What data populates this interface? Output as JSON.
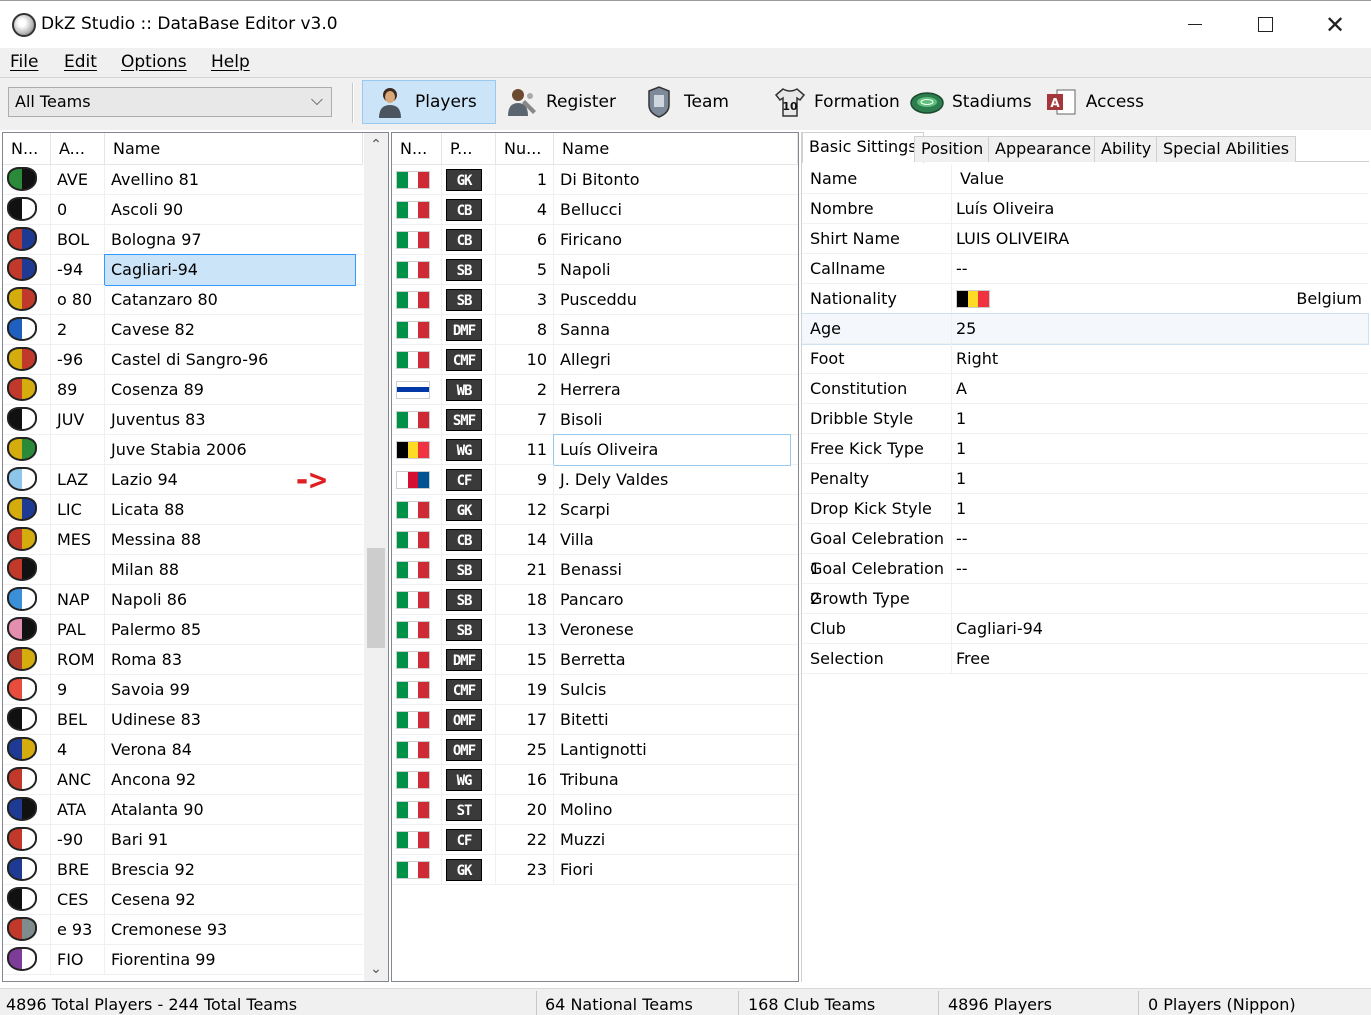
{
  "window": {
    "title": "DkZ Studio :: DataBase Editor v3.0"
  },
  "menu": {
    "file": "File",
    "edit": "Edit",
    "options": "Options",
    "help": "Help"
  },
  "toolbar": {
    "team_filter": "All Teams",
    "players": "Players",
    "register": "Register",
    "team": "Team",
    "formation": "Formation",
    "stadiums": "Stadiums",
    "access": "Access"
  },
  "team_list": {
    "columns": [
      "N...",
      "A...",
      "Name"
    ],
    "rows": [
      {
        "abbr": "AVE",
        "name": "Avellino 81",
        "c1": "#2a8a3a",
        "c2": "#111111"
      },
      {
        "abbr": "0",
        "name": "Ascoli 90",
        "c1": "#111111",
        "c2": "#ffffff"
      },
      {
        "abbr": "BOL",
        "name": "Bologna 97",
        "c1": "#c0392b",
        "c2": "#1f3a93"
      },
      {
        "abbr": "-94",
        "name": "Cagliari-94",
        "c1": "#c0392b",
        "c2": "#1f3a93"
      },
      {
        "abbr": "o 80",
        "name": "Catanzaro 80",
        "c1": "#d4ac0d",
        "c2": "#c0392b"
      },
      {
        "abbr": "2",
        "name": "Cavese 82",
        "c1": "#1f5fbf",
        "c2": "#ffffff"
      },
      {
        "abbr": "-96",
        "name": "Castel di Sangro-96",
        "c1": "#d4ac0d",
        "c2": "#c0392b"
      },
      {
        "abbr": "89",
        "name": "Cosenza 89",
        "c1": "#c0392b",
        "c2": "#d4ac0d"
      },
      {
        "abbr": "JUV",
        "name": "Juventus 83",
        "c1": "#111111",
        "c2": "#ffffff"
      },
      {
        "abbr": "",
        "name": "Juve Stabia 2006",
        "c1": "#d4ac0d",
        "c2": "#2a8a3a"
      },
      {
        "abbr": "LAZ",
        "name": "Lazio 94",
        "c1": "#8ec5ea",
        "c2": "#ffffff"
      },
      {
        "abbr": "LIC",
        "name": "Licata 88",
        "c1": "#d4ac0d",
        "c2": "#1f3a93"
      },
      {
        "abbr": "MES",
        "name": "Messina 88",
        "c1": "#c0392b",
        "c2": "#d4ac0d"
      },
      {
        "abbr": "",
        "name": "Milan 88",
        "c1": "#c0392b",
        "c2": "#111111"
      },
      {
        "abbr": "NAP",
        "name": "Napoli 86",
        "c1": "#3b8fd9",
        "c2": "#ffffff"
      },
      {
        "abbr": "PAL",
        "name": "Palermo 85",
        "c1": "#e58fb0",
        "c2": "#111111"
      },
      {
        "abbr": "ROM",
        "name": "Roma 83",
        "c1": "#b03a2e",
        "c2": "#d4ac0d"
      },
      {
        "abbr": "9",
        "name": "Savoia 99",
        "c1": "#e74c3c",
        "c2": "#ffffff"
      },
      {
        "abbr": "BEL",
        "name": "Udinese 83",
        "c1": "#111111",
        "c2": "#ffffff"
      },
      {
        "abbr": "4",
        "name": "Verona 84",
        "c1": "#1f3a93",
        "c2": "#d4ac0d"
      },
      {
        "abbr": "ANC",
        "name": "Ancona 92",
        "c1": "#c0392b",
        "c2": "#ffffff"
      },
      {
        "abbr": "ATA",
        "name": "Atalanta 90",
        "c1": "#1f3a93",
        "c2": "#111111"
      },
      {
        "abbr": "-90",
        "name": "Bari 91",
        "c1": "#c0392b",
        "c2": "#ffffff"
      },
      {
        "abbr": "BRE",
        "name": "Brescia 92",
        "c1": "#1f3a93",
        "c2": "#ffffff"
      },
      {
        "abbr": "CES",
        "name": "Cesena 92",
        "c1": "#111111",
        "c2": "#ffffff"
      },
      {
        "abbr": "e 93",
        "name": "Cremonese 93",
        "c1": "#c0392b",
        "c2": "#7f8c8d"
      },
      {
        "abbr": "FIO",
        "name": "Fiorentina 99",
        "c1": "#7d3c98",
        "c2": "#ffffff"
      }
    ]
  },
  "player_list": {
    "columns": [
      "N...",
      "P...",
      "Nu...",
      "Name"
    ],
    "rows": [
      {
        "flag": "italy",
        "pos": "GK",
        "num": "1",
        "name": "Di Bitonto"
      },
      {
        "flag": "italy",
        "pos": "CB",
        "num": "4",
        "name": "Bellucci"
      },
      {
        "flag": "italy",
        "pos": "CB",
        "num": "6",
        "name": "Firicano"
      },
      {
        "flag": "italy",
        "pos": "SB",
        "num": "5",
        "name": "Napoli"
      },
      {
        "flag": "italy",
        "pos": "SB",
        "num": "3",
        "name": "Pusceddu"
      },
      {
        "flag": "italy",
        "pos": "DMF",
        "num": "8",
        "name": "Sanna"
      },
      {
        "flag": "italy",
        "pos": "CMF",
        "num": "10",
        "name": "Allegri"
      },
      {
        "flag": "uruguay",
        "pos": "WB",
        "num": "2",
        "name": "Herrera"
      },
      {
        "flag": "italy",
        "pos": "SMF",
        "num": "7",
        "name": "Bisoli"
      },
      {
        "flag": "belgium",
        "pos": "WG",
        "num": "11",
        "name": "Luís Oliveira"
      },
      {
        "flag": "panama",
        "pos": "CF",
        "num": "9",
        "name": "J. Dely Valdes"
      },
      {
        "flag": "italy",
        "pos": "GK",
        "num": "12",
        "name": "Scarpi"
      },
      {
        "flag": "italy",
        "pos": "CB",
        "num": "14",
        "name": "Villa"
      },
      {
        "flag": "italy",
        "pos": "SB",
        "num": "21",
        "name": "Benassi"
      },
      {
        "flag": "italy",
        "pos": "SB",
        "num": "18",
        "name": "Pancaro"
      },
      {
        "flag": "italy",
        "pos": "SB",
        "num": "13",
        "name": "Veronese"
      },
      {
        "flag": "italy",
        "pos": "DMF",
        "num": "15",
        "name": "Berretta"
      },
      {
        "flag": "italy",
        "pos": "CMF",
        "num": "19",
        "name": "Sulcis"
      },
      {
        "flag": "italy",
        "pos": "OMF",
        "num": "17",
        "name": "Bitetti"
      },
      {
        "flag": "italy",
        "pos": "OMF",
        "num": "25",
        "name": "Lantignotti"
      },
      {
        "flag": "italy",
        "pos": "WG",
        "num": "16",
        "name": "Tribuna"
      },
      {
        "flag": "italy",
        "pos": "ST",
        "num": "20",
        "name": "Molino"
      },
      {
        "flag": "italy",
        "pos": "CF",
        "num": "22",
        "name": "Muzzi"
      },
      {
        "flag": "italy",
        "pos": "GK",
        "num": "23",
        "name": "Fiori"
      }
    ]
  },
  "flags": {
    "italy": [
      "#009246",
      "#ffffff",
      "#ce2b37"
    ],
    "belgium": [
      "#000000",
      "#fdda24",
      "#ef3340"
    ],
    "uruguay": [
      "#ffffff",
      "#0038a8",
      "#ffffff"
    ],
    "panama": [
      "#ffffff",
      "#d21034",
      "#005293"
    ]
  },
  "tabs": [
    "Basic Sittings",
    "Position",
    "Appearance",
    "Ability",
    "Special Abilities"
  ],
  "properties": {
    "header": {
      "key": "Name",
      "value": "Value"
    },
    "rows": [
      {
        "key": "Nombre",
        "value": "Luís Oliveira"
      },
      {
        "key": "Shirt Name",
        "value": "LUIS OLIVEIRA"
      },
      {
        "key": "Callname",
        "value": "--"
      },
      {
        "key": "Nationality",
        "value": "Belgium"
      },
      {
        "key": "Age",
        "value": "25"
      },
      {
        "key": "Foot",
        "value": "Right"
      },
      {
        "key": "Constitution",
        "value": "A"
      },
      {
        "key": "Dribble Style",
        "value": "1"
      },
      {
        "key": "Free Kick Type",
        "value": "1"
      },
      {
        "key": "Penalty",
        "value": "1"
      },
      {
        "key": "Drop Kick Style",
        "value": "1"
      },
      {
        "key": "Goal Celebration 1",
        "value": "--"
      },
      {
        "key": "Goal Celebration 2",
        "value": "--"
      },
      {
        "key": "Growth Type",
        "value": ""
      },
      {
        "key": "Club",
        "value": "Cagliari-94"
      },
      {
        "key": "Selection",
        "value": "Free"
      }
    ]
  },
  "annotation": {
    "arrow": "->"
  },
  "status": {
    "totals": "4896 Total Players  -  244 Total Teams",
    "national": "64 National Teams",
    "club": "168 Club Teams",
    "players": "4896 Players",
    "nippon": "0 Players (Nippon)"
  }
}
